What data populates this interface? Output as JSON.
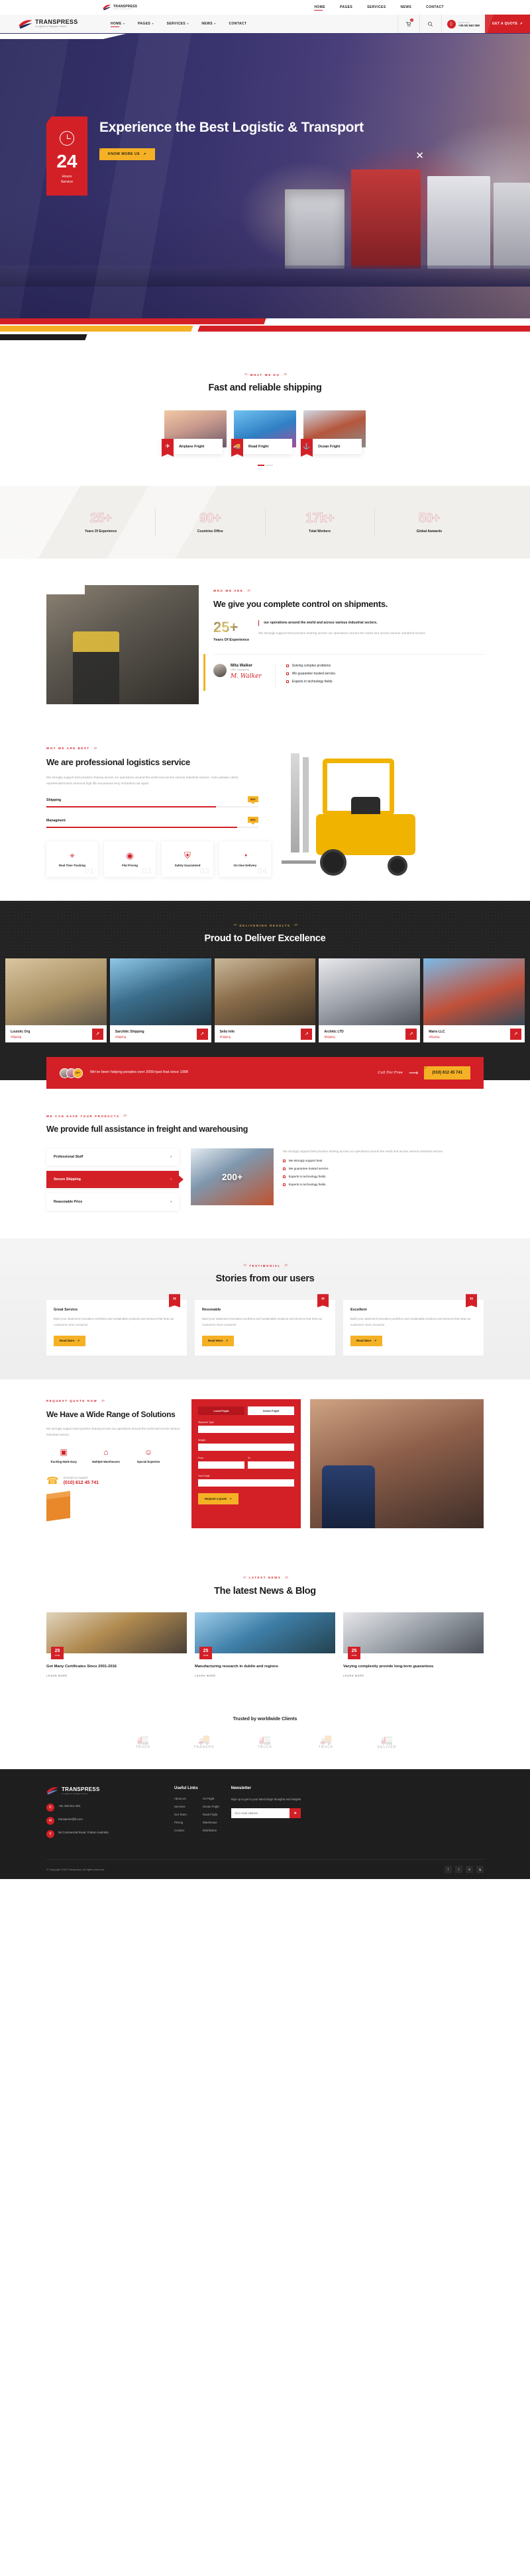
{
  "topbar": {
    "brand": "TRANSPRESS",
    "nav": [
      "HOME",
      "PAGES",
      "SERVICES",
      "NEWS",
      "CONTACT"
    ]
  },
  "header": {
    "brand": "TRANSPRESS",
    "tagline": "A Logistic & Transport Theme",
    "nav": [
      "HOME",
      "PAGES",
      "SERVICES",
      "NEWS",
      "CONTACT"
    ],
    "cart_count": "0",
    "call_label": "Call Us Now",
    "phone": "+36 55 540 069",
    "quote_button": "GET A QUOTE"
  },
  "hero": {
    "badge_number": "24",
    "badge_label": "Hours\nService",
    "title": "Experience the Best Logistic & Transport",
    "button": "KNOW MORE US",
    "close": "✕"
  },
  "whatwedo": {
    "eyebrow": "WHAT WE DO",
    "title": "Fast and reliable shipping",
    "cards": [
      {
        "name": "Airplane Fright",
        "icon": "airplane-icon"
      },
      {
        "name": "Road Fright",
        "icon": "truck-icon"
      },
      {
        "name": "Ocean Fright",
        "icon": "ship-icon"
      }
    ]
  },
  "stats": [
    {
      "value": "25+",
      "label": "Years Of Experience"
    },
    {
      "value": "90+",
      "label": "Countries Office"
    },
    {
      "value": "17k+",
      "label": "Total Workers"
    },
    {
      "value": "50+",
      "label": "Global Awwards"
    }
  ],
  "whoweare": {
    "eyebrow": "WHO WE ARE",
    "title": "We give you complete control on shipments.",
    "exp_number": "25+",
    "exp_label": "Years Of Experience",
    "quote": "our operations around the world and across various industrial sectors.",
    "paragraph": "We strongly support best practice sharing across our operations around the world and across various industrial sectors.",
    "ceo_name": "Mita Walker",
    "ceo_role": "CEO,Transpress",
    "signature": "M. Walker",
    "checks": [
      "Solving complex problems",
      "We guarantee trusted service.",
      "Experts in technology fields"
    ]
  },
  "best": {
    "eyebrow": "WHY WE ARE BEST",
    "title": "We are professional logistics service",
    "paragraph": "We strongly support best practice sharing across our operations around the world and across various industrial sectors. Anim pariatur cliche reprehenderit,enim eiusmod high life accusamus terry richardson ad squid.",
    "skills": [
      {
        "name": "Shipping",
        "percent": "80%",
        "value": 80
      },
      {
        "name": "Managment",
        "percent": "90%",
        "value": 90
      }
    ],
    "features": [
      {
        "name": "Real Time Tracking",
        "icon": "map-pin-icon",
        "num": "01"
      },
      {
        "name": "Flat Pricing",
        "icon": "network-icon",
        "num": "02"
      },
      {
        "name": "Safety Guaranteed",
        "icon": "shield-icon",
        "num": "03"
      },
      {
        "name": "On time Delivery",
        "icon": "clock-icon",
        "num": "04"
      }
    ]
  },
  "projects": {
    "eyebrow": "DELIVERING RESULTS",
    "title": "Proud to Deliver Excellence",
    "items": [
      {
        "name": "Louistic Org",
        "cat": "Shipping"
      },
      {
        "name": "Sarchitic Shipping",
        "cat": "Shipping"
      },
      {
        "name": "Selio Info",
        "cat": "Shipping"
      },
      {
        "name": "Architic LTD",
        "cat": "Shipping"
      },
      {
        "name": "Mario LLC",
        "cat": "Shipping"
      }
    ]
  },
  "cta": {
    "avatar_count": "2K+",
    "text": "We've been helping peoples over 2000+just that since 1998",
    "call_label": "Call For Free",
    "phone": "(010) 612 45 741"
  },
  "assist": {
    "eyebrow": "WE CAN HAVE YOUR PRODUCTS",
    "title": "We provide full assistance in freight and warehousing",
    "tabs": [
      "Professional Stuff",
      "Secure Shipping",
      "Reasonable Price"
    ],
    "active_tab": "Secure Shipping",
    "image_count": "200+",
    "paragraph": "We strongly support best practice sharing across our operations around the world and across various industrial sectors.",
    "checks": [
      "We strongly support best",
      "We guarantee trusted service",
      "Experts in technology fields",
      "Experts in technology fields"
    ]
  },
  "testimonial": {
    "eyebrow": "TESTIMONIAL",
    "title": "Stories from our users",
    "cards": [
      {
        "title": "Great Service",
        "text": "Build your statement innovative portfolios and sustainable products and services that help our customers meet consumer",
        "button": "Read More"
      },
      {
        "title": "Resonable",
        "text": "Build your statement innovative portfolios and sustainable products and services that help our customers meet consumer",
        "button": "Read More"
      },
      {
        "title": "Excellent",
        "text": "Build your statement innovative portfolios and sustainable products and services that help our customers meet consumer",
        "button": "Read More"
      }
    ]
  },
  "solutions": {
    "eyebrow": "REQUEST QUOTE NOW",
    "title": "We Have a Wide Range of Solutions",
    "paragraph": "We strongly support best practice sharing across our operations around the world and across various industrial sectors.",
    "icons": [
      {
        "label": "Tracking Made Easy",
        "icon": "box-icon"
      },
      {
        "label": "Multiple Warehouses",
        "icon": "warehouse-icon"
      },
      {
        "label": "Special Expertise",
        "icon": "expert-icon"
      }
    ],
    "emergency_label": "Emergency Support",
    "emergency_phone": "(010) 612 45 741",
    "form": {
      "tabs": [
        "Local Fright",
        "Ocean Fright"
      ],
      "active_tab": "Local Fright",
      "fields": [
        {
          "label": "Shipment Type",
          "value": ""
        },
        {
          "label": "Weight",
          "value": ""
        },
        {
          "label": "From",
          "value": ""
        },
        {
          "label": "To",
          "value": ""
        },
        {
          "label": "Your Email",
          "value": ""
        }
      ],
      "button": "Request a Quote"
    }
  },
  "blog": {
    "eyebrow": "LATEST NEWS",
    "title": "The latest News & Blog",
    "posts": [
      {
        "day": "25",
        "month": "JUNE",
        "title": "Got Many Certificates Since 2001-2016",
        "more": "LEARN MORE"
      },
      {
        "day": "25",
        "month": "JUNE",
        "title": "Manufacturing research in dublin and regions",
        "more": "LEARN MORE"
      },
      {
        "day": "25",
        "month": "JUNE",
        "title": "Varying complexity provide long-term guarantees",
        "more": "LEARN MORE"
      }
    ]
  },
  "clients": {
    "title": "Trusted by worldwide Clients",
    "logos": [
      "TRUCK",
      "TRANSPO",
      "TRUCK",
      "TRUCK",
      "DELIVER"
    ]
  },
  "footer": {
    "brand": "TRANSPRESS",
    "tagline": "A Logistic & Transport Theme",
    "contacts": [
      {
        "icon": "phone-icon",
        "text": "+61 426 814 294"
      },
      {
        "icon": "mail-icon",
        "text": "transpress@b.com"
      },
      {
        "icon": "pin-icon",
        "text": "56 Commercial Road, Fratton Australia"
      }
    ],
    "links_title": "Useful Links",
    "links_col1": [
      "About Us",
      "Services",
      "Our Team",
      "Pricing",
      "Contact"
    ],
    "links_col2": [
      "Air Fright",
      "Ocean Fright",
      "Road Fright",
      "Warehouse",
      "Distribution"
    ],
    "news_title": "Newsletter",
    "news_text": "Sign up to get to your latest blogs thoughts and insights",
    "news_placeholder": "Your email address",
    "news_button": "➤",
    "copyright": "© Copyright 2024 Transpress | All rights reserved.",
    "social": [
      "f",
      "t",
      "in",
      "ig"
    ]
  }
}
